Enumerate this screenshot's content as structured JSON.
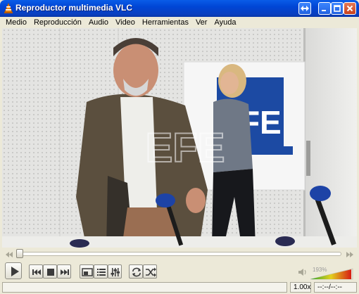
{
  "window": {
    "title": "Reproductor multimedia VLC"
  },
  "menu": {
    "items": [
      "Medio",
      "Reproducción",
      "Audio",
      "Video",
      "Herramientas",
      "Ver",
      "Ayuda"
    ]
  },
  "video": {
    "watermark_text": "EFE",
    "background_sign_text": "EFE"
  },
  "controls": {
    "volume_percent": "193%",
    "icons": [
      "play-icon",
      "previous-icon",
      "stop-icon",
      "next-icon",
      "fullscreen-icon",
      "playlist-icon",
      "extended-settings-icon",
      "loop-icon",
      "shuffle-icon",
      "volume-icon"
    ]
  },
  "status": {
    "speed": "1.00x",
    "time": "--:--/--:--"
  },
  "colors": {
    "titlebar": "#0a5ce8",
    "background": "#ece9d8",
    "close_button": "#c7401c",
    "volume_gradient_low": "#2ea52e",
    "volume_gradient_high": "#d71c14"
  }
}
